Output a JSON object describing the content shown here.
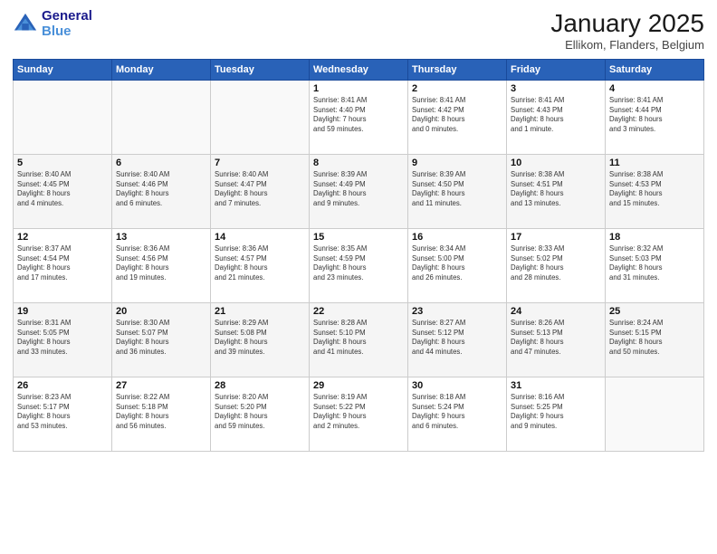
{
  "header": {
    "logo_line1": "General",
    "logo_line2": "Blue",
    "month": "January 2025",
    "location": "Ellikom, Flanders, Belgium"
  },
  "weekdays": [
    "Sunday",
    "Monday",
    "Tuesday",
    "Wednesday",
    "Thursday",
    "Friday",
    "Saturday"
  ],
  "weeks": [
    [
      {
        "day": "",
        "info": ""
      },
      {
        "day": "",
        "info": ""
      },
      {
        "day": "",
        "info": ""
      },
      {
        "day": "1",
        "info": "Sunrise: 8:41 AM\nSunset: 4:40 PM\nDaylight: 7 hours\nand 59 minutes."
      },
      {
        "day": "2",
        "info": "Sunrise: 8:41 AM\nSunset: 4:42 PM\nDaylight: 8 hours\nand 0 minutes."
      },
      {
        "day": "3",
        "info": "Sunrise: 8:41 AM\nSunset: 4:43 PM\nDaylight: 8 hours\nand 1 minute."
      },
      {
        "day": "4",
        "info": "Sunrise: 8:41 AM\nSunset: 4:44 PM\nDaylight: 8 hours\nand 3 minutes."
      }
    ],
    [
      {
        "day": "5",
        "info": "Sunrise: 8:40 AM\nSunset: 4:45 PM\nDaylight: 8 hours\nand 4 minutes."
      },
      {
        "day": "6",
        "info": "Sunrise: 8:40 AM\nSunset: 4:46 PM\nDaylight: 8 hours\nand 6 minutes."
      },
      {
        "day": "7",
        "info": "Sunrise: 8:40 AM\nSunset: 4:47 PM\nDaylight: 8 hours\nand 7 minutes."
      },
      {
        "day": "8",
        "info": "Sunrise: 8:39 AM\nSunset: 4:49 PM\nDaylight: 8 hours\nand 9 minutes."
      },
      {
        "day": "9",
        "info": "Sunrise: 8:39 AM\nSunset: 4:50 PM\nDaylight: 8 hours\nand 11 minutes."
      },
      {
        "day": "10",
        "info": "Sunrise: 8:38 AM\nSunset: 4:51 PM\nDaylight: 8 hours\nand 13 minutes."
      },
      {
        "day": "11",
        "info": "Sunrise: 8:38 AM\nSunset: 4:53 PM\nDaylight: 8 hours\nand 15 minutes."
      }
    ],
    [
      {
        "day": "12",
        "info": "Sunrise: 8:37 AM\nSunset: 4:54 PM\nDaylight: 8 hours\nand 17 minutes."
      },
      {
        "day": "13",
        "info": "Sunrise: 8:36 AM\nSunset: 4:56 PM\nDaylight: 8 hours\nand 19 minutes."
      },
      {
        "day": "14",
        "info": "Sunrise: 8:36 AM\nSunset: 4:57 PM\nDaylight: 8 hours\nand 21 minutes."
      },
      {
        "day": "15",
        "info": "Sunrise: 8:35 AM\nSunset: 4:59 PM\nDaylight: 8 hours\nand 23 minutes."
      },
      {
        "day": "16",
        "info": "Sunrise: 8:34 AM\nSunset: 5:00 PM\nDaylight: 8 hours\nand 26 minutes."
      },
      {
        "day": "17",
        "info": "Sunrise: 8:33 AM\nSunset: 5:02 PM\nDaylight: 8 hours\nand 28 minutes."
      },
      {
        "day": "18",
        "info": "Sunrise: 8:32 AM\nSunset: 5:03 PM\nDaylight: 8 hours\nand 31 minutes."
      }
    ],
    [
      {
        "day": "19",
        "info": "Sunrise: 8:31 AM\nSunset: 5:05 PM\nDaylight: 8 hours\nand 33 minutes."
      },
      {
        "day": "20",
        "info": "Sunrise: 8:30 AM\nSunset: 5:07 PM\nDaylight: 8 hours\nand 36 minutes."
      },
      {
        "day": "21",
        "info": "Sunrise: 8:29 AM\nSunset: 5:08 PM\nDaylight: 8 hours\nand 39 minutes."
      },
      {
        "day": "22",
        "info": "Sunrise: 8:28 AM\nSunset: 5:10 PM\nDaylight: 8 hours\nand 41 minutes."
      },
      {
        "day": "23",
        "info": "Sunrise: 8:27 AM\nSunset: 5:12 PM\nDaylight: 8 hours\nand 44 minutes."
      },
      {
        "day": "24",
        "info": "Sunrise: 8:26 AM\nSunset: 5:13 PM\nDaylight: 8 hours\nand 47 minutes."
      },
      {
        "day": "25",
        "info": "Sunrise: 8:24 AM\nSunset: 5:15 PM\nDaylight: 8 hours\nand 50 minutes."
      }
    ],
    [
      {
        "day": "26",
        "info": "Sunrise: 8:23 AM\nSunset: 5:17 PM\nDaylight: 8 hours\nand 53 minutes."
      },
      {
        "day": "27",
        "info": "Sunrise: 8:22 AM\nSunset: 5:18 PM\nDaylight: 8 hours\nand 56 minutes."
      },
      {
        "day": "28",
        "info": "Sunrise: 8:20 AM\nSunset: 5:20 PM\nDaylight: 8 hours\nand 59 minutes."
      },
      {
        "day": "29",
        "info": "Sunrise: 8:19 AM\nSunset: 5:22 PM\nDaylight: 9 hours\nand 2 minutes."
      },
      {
        "day": "30",
        "info": "Sunrise: 8:18 AM\nSunset: 5:24 PM\nDaylight: 9 hours\nand 6 minutes."
      },
      {
        "day": "31",
        "info": "Sunrise: 8:16 AM\nSunset: 5:25 PM\nDaylight: 9 hours\nand 9 minutes."
      },
      {
        "day": "",
        "info": ""
      }
    ]
  ]
}
